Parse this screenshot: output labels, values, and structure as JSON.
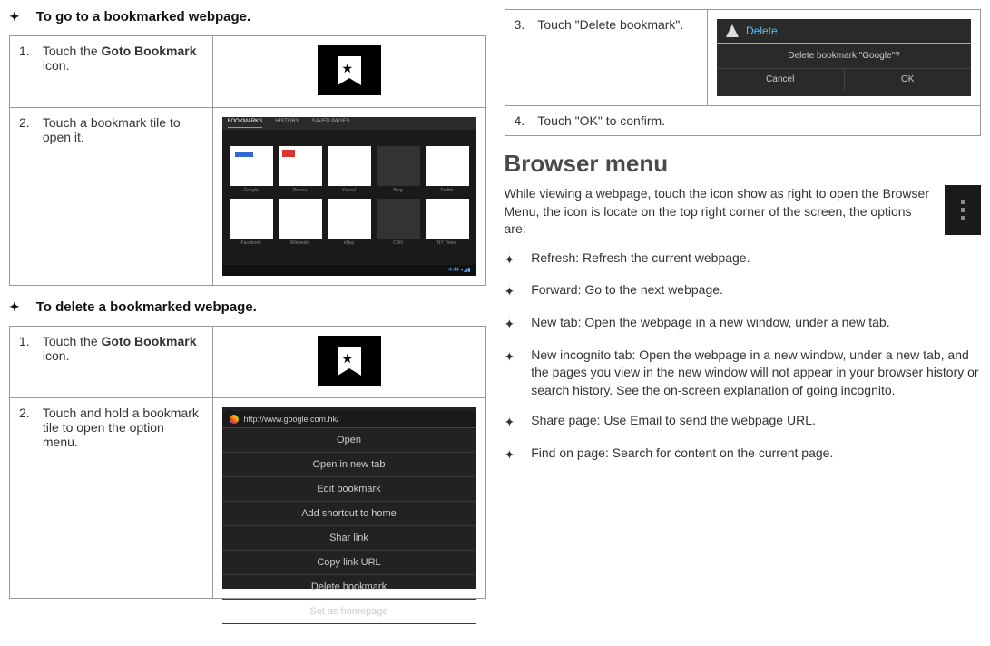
{
  "left": {
    "heading1": "To go to a bookmarked webpage.",
    "table1": {
      "rows": [
        {
          "num": "1.",
          "pre": "Touch the ",
          "bold": "Goto Bookmark",
          "post": " icon."
        },
        {
          "num": "2.",
          "text": "Touch a bookmark tile to open it."
        }
      ]
    },
    "heading2": "To delete a bookmarked webpage.",
    "table2": {
      "rows": [
        {
          "num": "1.",
          "pre": "Touch the ",
          "bold": "Goto Bookmark",
          "post": " icon."
        },
        {
          "num": "2.",
          "text": "Touch and hold a bookmark tile to open the option menu."
        }
      ]
    },
    "tiles_tabs": [
      "BOOKMARKS",
      "HISTORY",
      "SAVED PAGES"
    ],
    "tile_labels": [
      "Google",
      "Picasa",
      "Yahoo!",
      "Bing",
      "Twitter",
      "Facebook",
      "Wikipedia",
      "eBay",
      "CNN",
      "NY Times"
    ],
    "context_url": "http://www.google.com.hk/",
    "context_items": [
      "Open",
      "Open in new tab",
      "Edit bookmark",
      "Add shortcut to home",
      "Shar link",
      "Copy link URL",
      "Delete bookmark",
      "Set as homepage"
    ]
  },
  "right": {
    "table3": {
      "rows": [
        {
          "num": "3.",
          "text": "Touch \"Delete bookmark\"."
        },
        {
          "num": "4.",
          "text": "Touch \"OK\" to confirm."
        }
      ]
    },
    "dialog": {
      "title": "Delete",
      "body": "Delete bookmark \"Google\"?",
      "cancel": "Cancel",
      "ok": "OK"
    },
    "h2": "Browser menu",
    "intro": "While viewing a webpage, touch the icon show as right to open the Browser Menu, the icon is locate on the top right corner of the screen, the options are:",
    "menu_items": [
      "Refresh: Refresh the current webpage.",
      "Forward: Go to the next webpage.",
      "New tab: Open the webpage in a new window, under a new tab.",
      "New incognito tab: Open the webpage in a new window, under a new tab, and the pages you view in the new window will not appear in your browser history or search history. See the on-screen explanation of going incognito.",
      "Share page: Use Email to send the webpage URL.",
      "Find on page: Search for content on the current page."
    ]
  }
}
